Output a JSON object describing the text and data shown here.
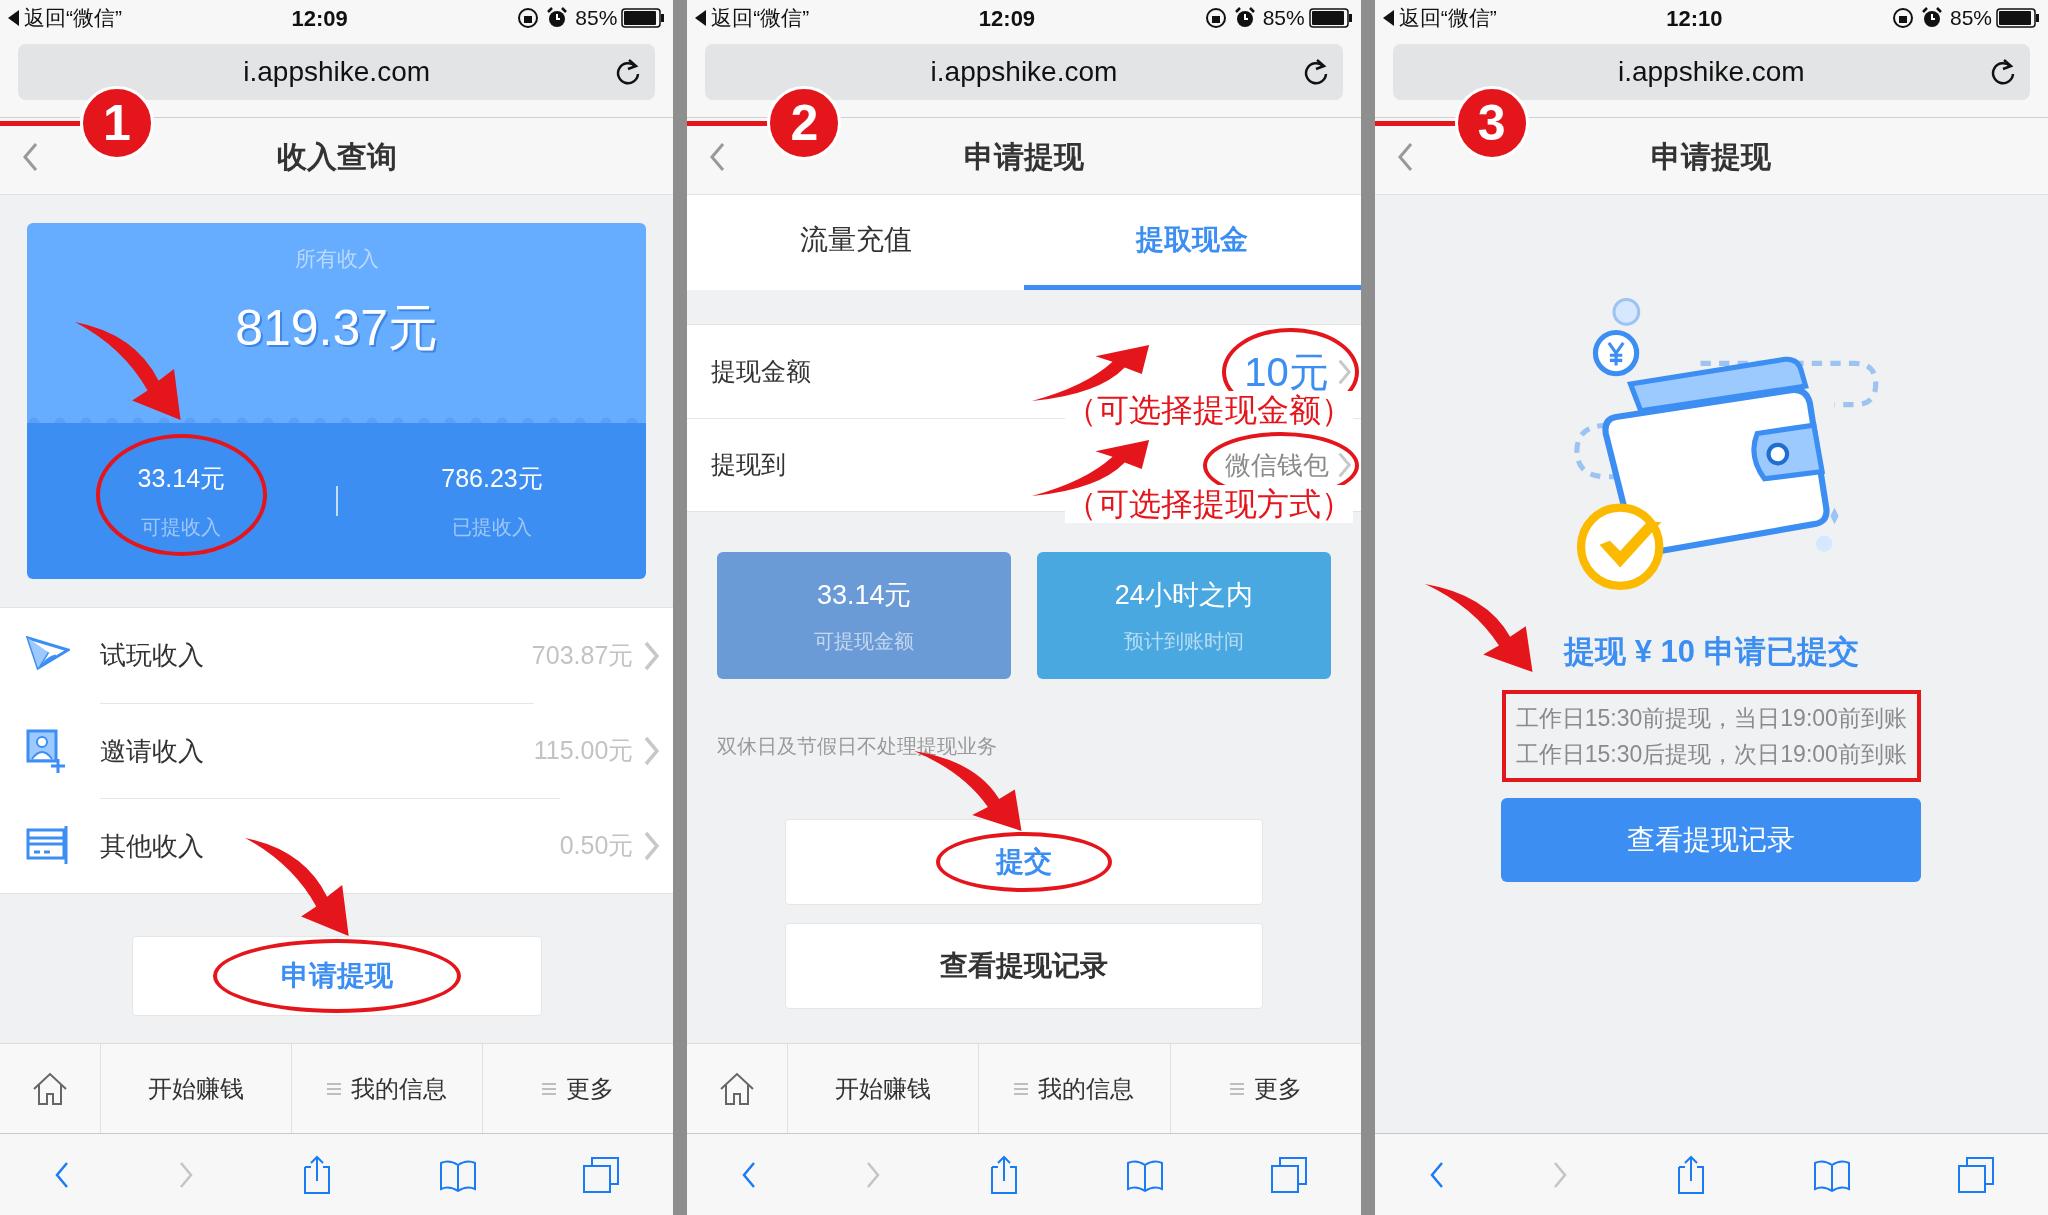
{
  "panels": [
    {
      "kind": "income",
      "step": "1",
      "status_bar": {
        "back_label": "返回“微信”",
        "time": "12:09",
        "battery": "85%"
      },
      "url": "i.appshike.com",
      "title": "收入查询",
      "summary": {
        "label": "所有收入",
        "total": "819.37元",
        "stats": [
          {
            "value": "33.14元",
            "label": "可提收入",
            "circled": true
          },
          {
            "value": "786.23元",
            "label": "已提收入",
            "circled": false
          }
        ]
      },
      "income_list": [
        {
          "kind": "plane",
          "label": "试玩收入",
          "value": "703.87元"
        },
        {
          "kind": "invite",
          "label": "邀请收入",
          "value": "115.00元"
        },
        {
          "kind": "card",
          "label": "其他收入",
          "value": "0.50元"
        }
      ],
      "action_button": {
        "label": "申请提现",
        "circled": true
      },
      "tab_bar": [
        {
          "kind": "home"
        },
        {
          "kind": "text",
          "label": "开始赚钱"
        },
        {
          "kind": "menu",
          "label": "我的信息"
        },
        {
          "kind": "menu",
          "label": "更多"
        }
      ],
      "toolbar": [
        {
          "kind": "back",
          "disabled": false
        },
        {
          "kind": "forward",
          "disabled": true
        },
        {
          "kind": "share",
          "disabled": false
        },
        {
          "kind": "bookmarks",
          "disabled": false
        },
        {
          "kind": "tabs",
          "disabled": false
        }
      ]
    },
    {
      "kind": "withdraw",
      "step": "2",
      "status_bar": {
        "back_label": "返回“微信”",
        "time": "12:09",
        "battery": "85%"
      },
      "url": "i.appshike.com",
      "title": "申请提现",
      "tabs": [
        {
          "label": "流量充值",
          "selected": false
        },
        {
          "label": "提取现金",
          "selected": true
        }
      ],
      "form_rows": [
        {
          "label": "提现金额",
          "value": "10元",
          "kind": "amount",
          "circled": true,
          "annotation": "（可选择提现金额）"
        },
        {
          "label": "提现到",
          "value": "微信钱包",
          "kind": "method",
          "circled": true,
          "annotation": "（可选择提现方式）"
        }
      ],
      "info_tiles": [
        {
          "value": "33.14元",
          "label": "可提现金额",
          "color": "#6a9bd6"
        },
        {
          "value": "24小时之内",
          "label": "预计到账时间",
          "color": "#4aa8e0"
        }
      ],
      "notice": "双休日及节假日不处理提现业务",
      "buttons": [
        {
          "label": "提交",
          "kind": "primary",
          "circled": true
        },
        {
          "label": "查看提现记录",
          "kind": "secondary",
          "circled": false
        }
      ],
      "tab_bar": [
        {
          "kind": "home"
        },
        {
          "kind": "text",
          "label": "开始赚钱"
        },
        {
          "kind": "menu",
          "label": "我的信息"
        },
        {
          "kind": "menu",
          "label": "更多"
        }
      ],
      "toolbar": [
        {
          "kind": "back",
          "disabled": false
        },
        {
          "kind": "forward",
          "disabled": true
        },
        {
          "kind": "share",
          "disabled": false
        },
        {
          "kind": "bookmarks",
          "disabled": false
        },
        {
          "kind": "tabs",
          "disabled": false
        }
      ]
    },
    {
      "kind": "submitted",
      "step": "3",
      "status_bar": {
        "back_label": "返回“微信”",
        "time": "12:10",
        "battery": "85%"
      },
      "url": "i.appshike.com",
      "title": "申请提现",
      "result_title": "提现 ¥ 10 申请已提交",
      "notes": [
        "工作日15:30前提现，当日19:00前到账",
        "工作日15:30后提现，次日19:00前到账"
      ],
      "notes_boxed": true,
      "button": "查看提现记录",
      "toolbar": [
        {
          "kind": "back",
          "disabled": false
        },
        {
          "kind": "forward",
          "disabled": true
        },
        {
          "kind": "share",
          "disabled": false
        },
        {
          "kind": "bookmarks",
          "disabled": false
        },
        {
          "kind": "tabs",
          "disabled": false
        }
      ]
    }
  ]
}
